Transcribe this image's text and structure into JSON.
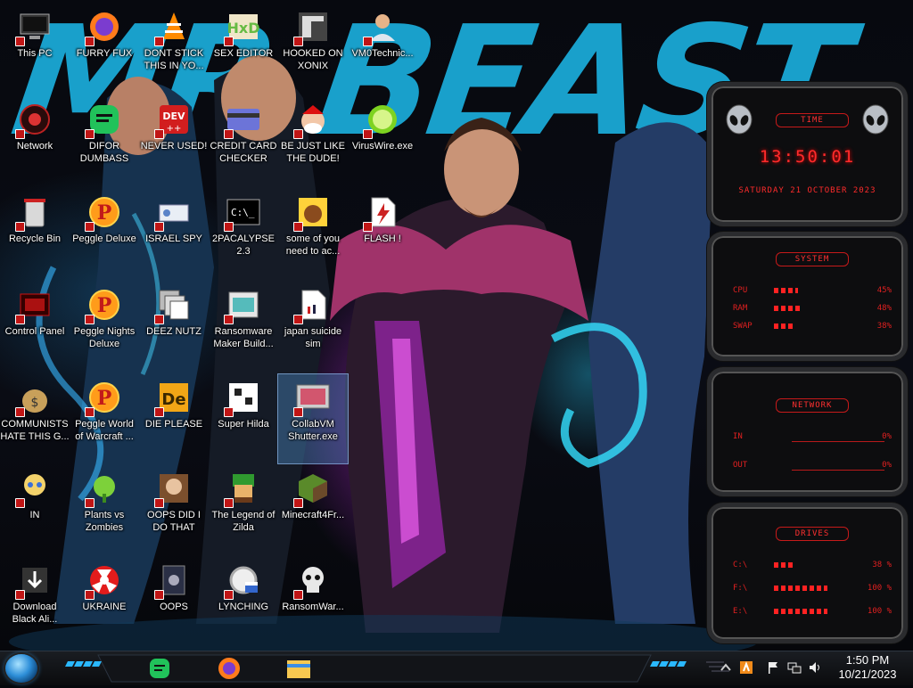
{
  "wallpaper": {
    "title_text": "MR BEAST"
  },
  "desktop_icons": [
    {
      "label": "This PC",
      "icon": "this-pc-icon"
    },
    {
      "label": "Network",
      "icon": "network-icon"
    },
    {
      "label": "Recycle Bin",
      "icon": "recycle-bin-icon"
    },
    {
      "label": "Control Panel",
      "icon": "control-panel-icon"
    },
    {
      "label": "COMMUNISTS HATE THIS G...",
      "icon": "money-bag-icon"
    },
    {
      "label": "IN",
      "icon": "cartoon-character-icon"
    },
    {
      "label": "Download Black Ali...",
      "icon": "download-icon"
    },
    {
      "label": "FURRY FUX",
      "icon": "firefox-icon"
    },
    {
      "label": "DIFOR DUMBASS",
      "icon": "discord-icon"
    },
    {
      "label": "Peggle Deluxe",
      "icon": "peggle-icon"
    },
    {
      "label": "Peggle Nights Deluxe",
      "icon": "peggle-icon"
    },
    {
      "label": "Peggle World of Warcraft ...",
      "icon": "peggle-icon"
    },
    {
      "label": "Plants vs Zombies",
      "icon": "plants-vs-zombies-icon"
    },
    {
      "label": "UKRAINE",
      "icon": "radiation-icon"
    },
    {
      "label": "DONT STICK THIS IN YO...",
      "icon": "vlc-cone-icon"
    },
    {
      "label": "NEVER USED!",
      "icon": "dev-cpp-icon"
    },
    {
      "label": "ISRAEL SPY",
      "icon": "spy-icon"
    },
    {
      "label": "DEEZ NUTZ",
      "icon": "windows-stack-icon"
    },
    {
      "label": "DIE PLEASE",
      "icon": "adobe-de-icon"
    },
    {
      "label": "OOPS DID I DO THAT",
      "icon": "portrait-icon"
    },
    {
      "label": "OOPS",
      "icon": "oops-icon"
    },
    {
      "label": "SEX EDITOR",
      "icon": "hxd-icon"
    },
    {
      "label": "CREDIT CARD CHECKER",
      "icon": "credit-card-icon"
    },
    {
      "label": "2PACALYPSE 2.3",
      "icon": "terminal-icon"
    },
    {
      "label": "Ransomware Maker Build...",
      "icon": "window-app-icon"
    },
    {
      "label": "Super Hilda",
      "icon": "pixel-game-icon"
    },
    {
      "label": "The Legend of Zilda",
      "icon": "zelda-pixel-icon"
    },
    {
      "label": "LYNCHING",
      "icon": "gear-flag-icon"
    },
    {
      "label": "HOOKED ON XONIX",
      "icon": "xonix-icon"
    },
    {
      "label": "BE JUST LIKE THE DUDE!",
      "icon": "santa-icon"
    },
    {
      "label": "some of you need to ac...",
      "icon": "beaver-icon"
    },
    {
      "label": "japan suicide sim",
      "icon": "file-icon"
    },
    {
      "label": "CollabVM Shutter.exe",
      "icon": "collabvm-icon"
    },
    {
      "label": "Minecraft4Fr...",
      "icon": "minecraft-icon"
    },
    {
      "label": "RansomWar...",
      "icon": "skull-icon"
    },
    {
      "label": "VM0Technic...",
      "icon": "technician-icon"
    },
    {
      "label": "VirusWire.exe",
      "icon": "lime-icon"
    },
    {
      "label": "FLASH !",
      "icon": "flash-icon"
    }
  ],
  "widget": {
    "time": {
      "header": "TIME",
      "clock": "13:50:01",
      "date": "SATURDAY 21 OCTOBER 2023"
    },
    "system": {
      "header": "SYSTEM",
      "rows": [
        {
          "label": "CPU",
          "value": "45%",
          "level": 0.45
        },
        {
          "label": "RAM",
          "value": "48%",
          "level": 0.48
        },
        {
          "label": "SWAP",
          "value": "38%",
          "level": 0.38
        }
      ]
    },
    "network": {
      "header": "NETWORK",
      "rows": [
        {
          "label": "IN",
          "value": "0%"
        },
        {
          "label": "OUT",
          "value": "0%"
        }
      ]
    },
    "drives": {
      "header": "DRIVES",
      "rows": [
        {
          "label": "C:\\",
          "value": "38 %",
          "level": 0.38
        },
        {
          "label": "F:\\",
          "value": "100 %",
          "level": 1.0
        },
        {
          "label": "E:\\",
          "value": "100 %",
          "level": 1.0
        }
      ]
    }
  },
  "taskbar": {
    "pinned": [
      {
        "icon": "discord-icon"
      },
      {
        "icon": "firefox-icon"
      },
      {
        "icon": "file-explorer-icon"
      }
    ],
    "tray": [
      {
        "icon": "show-hidden-icons-icon"
      },
      {
        "icon": "app-tray-icon"
      },
      {
        "icon": "action-center-flag-icon"
      },
      {
        "icon": "network-tray-icon"
      },
      {
        "icon": "volume-icon"
      }
    ],
    "clock": {
      "time": "1:50 PM",
      "date": "10/21/2023"
    }
  }
}
